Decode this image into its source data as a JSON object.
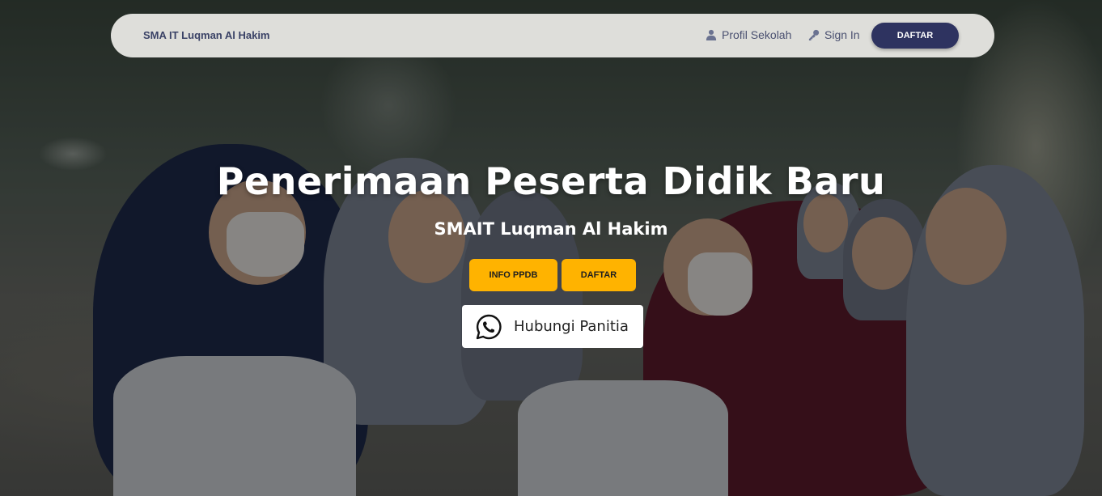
{
  "navbar": {
    "brand": "SMA IT Luqman Al Hakim",
    "links": [
      {
        "label": "Profil Sekolah",
        "icon": "user-icon"
      },
      {
        "label": "Sign In",
        "icon": "key-icon"
      }
    ],
    "cta_label": "DAFTAR"
  },
  "hero": {
    "title": "Penerimaan Peserta Didik Baru",
    "subtitle": "SMAIT Luqman Al Hakim",
    "buttons": {
      "info_label": "INFO PPDB",
      "daftar_label": "DAFTAR",
      "whatsapp_label": "Hubungi Panitia",
      "whatsapp_icon": "whatsapp-icon"
    }
  },
  "colors": {
    "navbar_bg": "#e8e8e4",
    "brand_text": "#3a4266",
    "cta_bg": "#2e3360",
    "accent_yellow": "#ffb300",
    "white": "#ffffff"
  }
}
